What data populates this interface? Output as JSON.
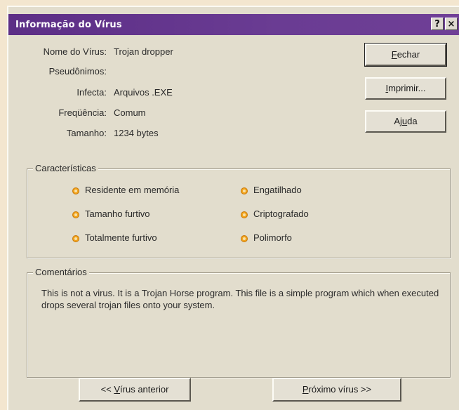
{
  "window": {
    "title": "Informação do Vírus",
    "help_glyph": "?",
    "close_glyph": "×"
  },
  "info": {
    "name_label": "Nome do Vírus:",
    "name_value": "Trojan dropper",
    "aliases_label": "Pseudônimos:",
    "aliases_value": "",
    "infects_label": "Infecta:",
    "infects_value": "Arquivos .EXE",
    "frequency_label": "Freqüência:",
    "frequency_value": "Comum",
    "size_label": "Tamanho:",
    "size_value": "1234 bytes"
  },
  "buttons": {
    "close": {
      "prefix": "",
      "accel": "F",
      "rest": "echar"
    },
    "print": {
      "prefix": "",
      "accel": "I",
      "rest": "mprimir..."
    },
    "help": {
      "prefix": "Aj",
      "accel": "u",
      "rest": "da"
    },
    "prev": {
      "prefix": "<< ",
      "accel": "V",
      "rest": "írus anterior"
    },
    "next": {
      "prefix": "",
      "accel": "P",
      "rest": "róximo vírus >>"
    }
  },
  "characteristics": {
    "label": "Características",
    "items": [
      "Residente em memória",
      "Tamanho furtivo",
      "Totalmente furtivo",
      "Engatilhado",
      "Criptografado",
      "Polimorfo"
    ]
  },
  "comments": {
    "label": "Comentários",
    "text": "This is not a virus. It is a Trojan Horse program. This file is a simple  program which when executed drops several trojan files onto your system."
  },
  "colors": {
    "titlebar": "#5c2e86",
    "dialog_bg": "#e2ddcd",
    "bullet": "#f2a41d"
  }
}
